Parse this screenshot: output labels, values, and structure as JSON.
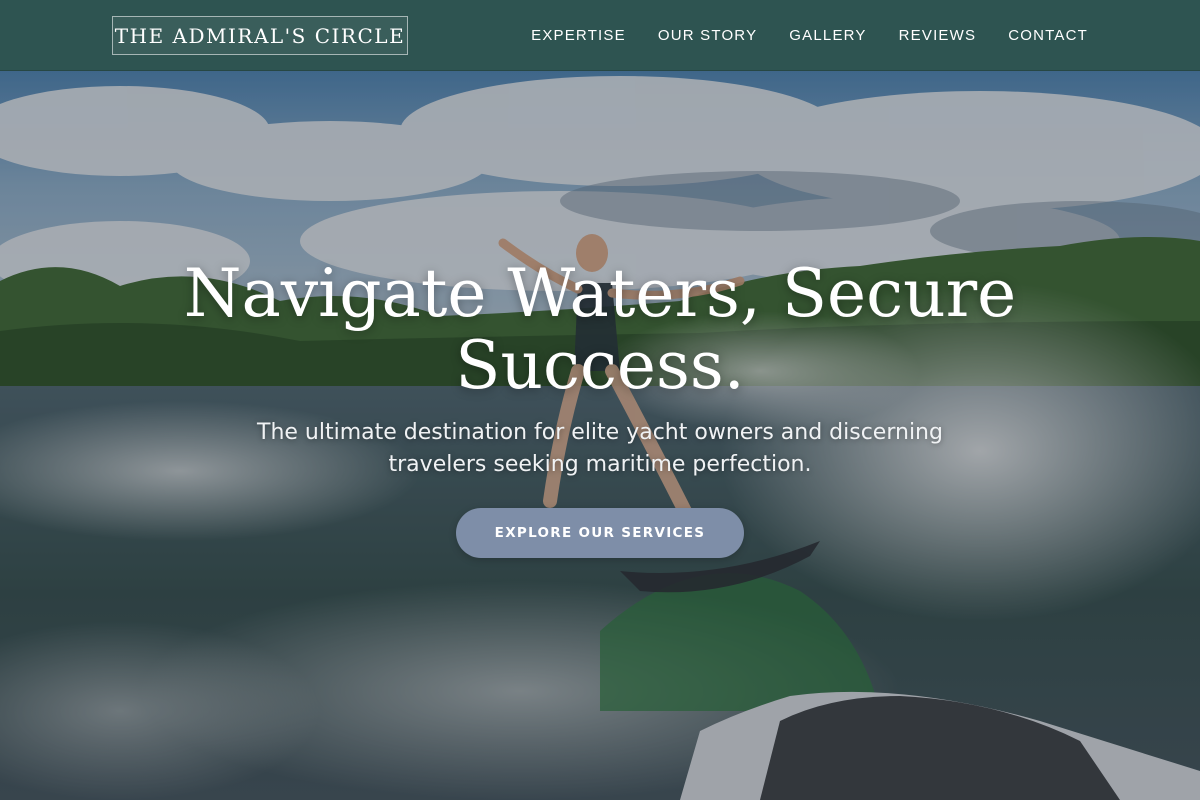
{
  "header": {
    "logo_text": "THE ADMIRAL'S CIRCLE",
    "nav": [
      {
        "label": "EXPERTISE"
      },
      {
        "label": "OUR STORY"
      },
      {
        "label": "GALLERY"
      },
      {
        "label": "REVIEWS"
      },
      {
        "label": "CONTACT"
      }
    ]
  },
  "hero": {
    "title": "Navigate Waters, Secure Success.",
    "subtitle": "The ultimate destination for elite yacht owners and discerning travelers seeking maritime perfection.",
    "cta_label": "EXPLORE OUR SERVICES"
  },
  "colors": {
    "header_bg": "#2e5451",
    "cta_bg": "#7e8ea8",
    "text": "#ffffff"
  }
}
